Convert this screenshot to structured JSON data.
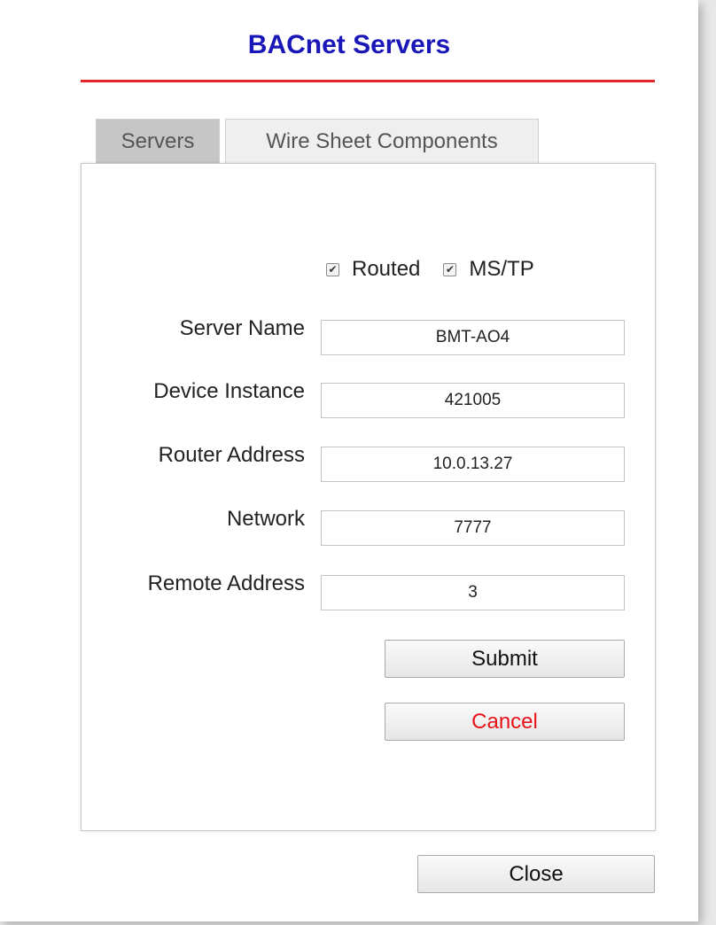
{
  "dialog": {
    "title": "BACnet Servers"
  },
  "tabs": [
    {
      "label": "Servers",
      "active": true
    },
    {
      "label": "Wire Sheet Components",
      "active": false
    }
  ],
  "checkboxes": {
    "routed": {
      "label": "Routed",
      "checked": true
    },
    "mstp": {
      "label": "MS/TP",
      "checked": true
    }
  },
  "fields": {
    "server_name": {
      "label": "Server Name",
      "value": "BMT-AO4"
    },
    "device_instance": {
      "label": "Device Instance",
      "value": "421005"
    },
    "router_address": {
      "label": "Router Address",
      "value": "10.0.13.27"
    },
    "network": {
      "label": "Network",
      "value": "7777"
    },
    "remote_address": {
      "label": "Remote Address",
      "value": "3"
    }
  },
  "buttons": {
    "submit": "Submit",
    "cancel": "Cancel",
    "close": "Close"
  },
  "colors": {
    "title": "#1a17b8",
    "title_rule": "#e3242b",
    "cancel_text": "#e8121a"
  },
  "icons": {
    "checkmark": "check-icon"
  }
}
